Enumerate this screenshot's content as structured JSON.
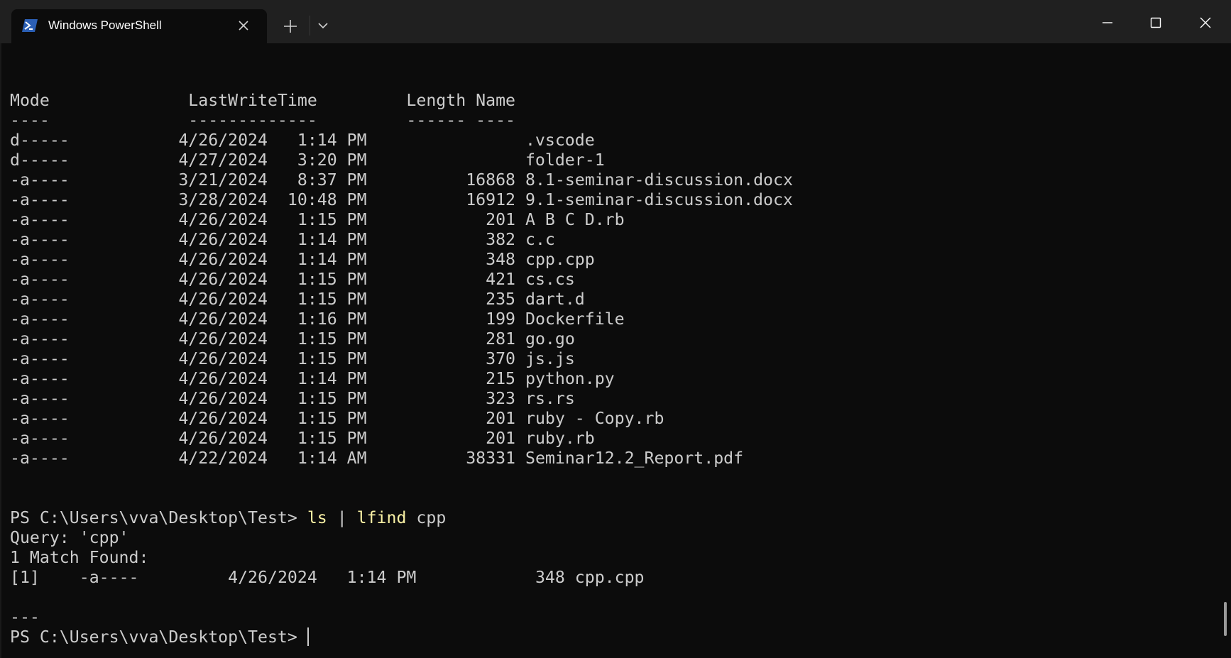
{
  "window": {
    "tab_title": "Windows PowerShell",
    "icons": {
      "tab": "powershell-icon",
      "close_tab": "close-icon",
      "new_tab": "plus-icon",
      "dropdown": "chevron-down-icon",
      "minimize": "minimize-icon",
      "maximize": "maximize-icon",
      "close_window": "close-icon"
    },
    "colors": {
      "background": "#0c0c0c",
      "titlebar": "#202020",
      "text": "#cccccc",
      "command": "#f9f1a5",
      "powershell_blue": "#2b5fb5"
    }
  },
  "listing": {
    "headers": {
      "mode": "Mode",
      "last_write_time": "LastWriteTime",
      "length": "Length",
      "name": "Name"
    },
    "underline": {
      "mode": "----",
      "last_write_time": "-------------",
      "length": "------",
      "name": "----"
    },
    "rows": [
      {
        "mode": "d-----",
        "date": "4/26/2024",
        "time": "1:14 PM",
        "length": "",
        "name": ".vscode"
      },
      {
        "mode": "d-----",
        "date": "4/27/2024",
        "time": "3:20 PM",
        "length": "",
        "name": "folder-1"
      },
      {
        "mode": "-a----",
        "date": "3/21/2024",
        "time": "8:37 PM",
        "length": "16868",
        "name": "8.1-seminar-discussion.docx"
      },
      {
        "mode": "-a----",
        "date": "3/28/2024",
        "time": "10:48 PM",
        "length": "16912",
        "name": "9.1-seminar-discussion.docx"
      },
      {
        "mode": "-a----",
        "date": "4/26/2024",
        "time": "1:15 PM",
        "length": "201",
        "name": "A B C D.rb"
      },
      {
        "mode": "-a----",
        "date": "4/26/2024",
        "time": "1:14 PM",
        "length": "382",
        "name": "c.c"
      },
      {
        "mode": "-a----",
        "date": "4/26/2024",
        "time": "1:14 PM",
        "length": "348",
        "name": "cpp.cpp"
      },
      {
        "mode": "-a----",
        "date": "4/26/2024",
        "time": "1:15 PM",
        "length": "421",
        "name": "cs.cs"
      },
      {
        "mode": "-a----",
        "date": "4/26/2024",
        "time": "1:15 PM",
        "length": "235",
        "name": "dart.d"
      },
      {
        "mode": "-a----",
        "date": "4/26/2024",
        "time": "1:16 PM",
        "length": "199",
        "name": "Dockerfile"
      },
      {
        "mode": "-a----",
        "date": "4/26/2024",
        "time": "1:15 PM",
        "length": "281",
        "name": "go.go"
      },
      {
        "mode": "-a----",
        "date": "4/26/2024",
        "time": "1:15 PM",
        "length": "370",
        "name": "js.js"
      },
      {
        "mode": "-a----",
        "date": "4/26/2024",
        "time": "1:14 PM",
        "length": "215",
        "name": "python.py"
      },
      {
        "mode": "-a----",
        "date": "4/26/2024",
        "time": "1:15 PM",
        "length": "323",
        "name": "rs.rs"
      },
      {
        "mode": "-a----",
        "date": "4/26/2024",
        "time": "1:15 PM",
        "length": "201",
        "name": "ruby - Copy.rb"
      },
      {
        "mode": "-a----",
        "date": "4/26/2024",
        "time": "1:15 PM",
        "length": "201",
        "name": "ruby.rb"
      },
      {
        "mode": "-a----",
        "date": "4/22/2024",
        "time": "1:14 AM",
        "length": "38331",
        "name": "Seminar12.2_Report.pdf"
      }
    ]
  },
  "session": {
    "prompt": "PS C:\\Users\\vva\\Desktop\\Test> ",
    "command_parts": {
      "ls": "ls",
      "pipe": " | ",
      "lfind": "lfind",
      "arg": " cpp"
    },
    "query_line": "Query: 'cpp'",
    "match_line": "1 Match Found:",
    "match_row": {
      "index": "[1]",
      "mode": "-a----",
      "date": "4/26/2024",
      "time": "1:14 PM",
      "length": "348",
      "name": "cpp.cpp"
    },
    "separator": "---",
    "final_prompt": "PS C:\\Users\\vva\\Desktop\\Test> "
  }
}
